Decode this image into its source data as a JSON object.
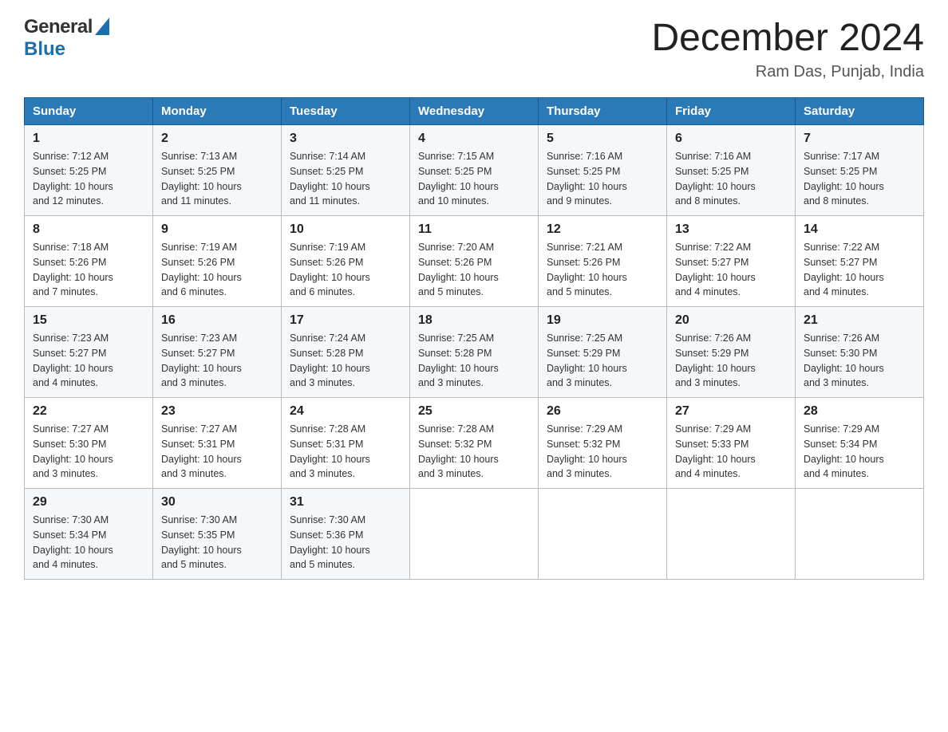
{
  "header": {
    "logo_general": "General",
    "logo_blue": "Blue",
    "month_title": "December 2024",
    "location": "Ram Das, Punjab, India"
  },
  "days_of_week": [
    "Sunday",
    "Monday",
    "Tuesday",
    "Wednesday",
    "Thursday",
    "Friday",
    "Saturday"
  ],
  "weeks": [
    [
      {
        "day": "1",
        "sunrise": "7:12 AM",
        "sunset": "5:25 PM",
        "daylight": "10 hours and 12 minutes."
      },
      {
        "day": "2",
        "sunrise": "7:13 AM",
        "sunset": "5:25 PM",
        "daylight": "10 hours and 11 minutes."
      },
      {
        "day": "3",
        "sunrise": "7:14 AM",
        "sunset": "5:25 PM",
        "daylight": "10 hours and 11 minutes."
      },
      {
        "day": "4",
        "sunrise": "7:15 AM",
        "sunset": "5:25 PM",
        "daylight": "10 hours and 10 minutes."
      },
      {
        "day": "5",
        "sunrise": "7:16 AM",
        "sunset": "5:25 PM",
        "daylight": "10 hours and 9 minutes."
      },
      {
        "day": "6",
        "sunrise": "7:16 AM",
        "sunset": "5:25 PM",
        "daylight": "10 hours and 8 minutes."
      },
      {
        "day": "7",
        "sunrise": "7:17 AM",
        "sunset": "5:25 PM",
        "daylight": "10 hours and 8 minutes."
      }
    ],
    [
      {
        "day": "8",
        "sunrise": "7:18 AM",
        "sunset": "5:26 PM",
        "daylight": "10 hours and 7 minutes."
      },
      {
        "day": "9",
        "sunrise": "7:19 AM",
        "sunset": "5:26 PM",
        "daylight": "10 hours and 6 minutes."
      },
      {
        "day": "10",
        "sunrise": "7:19 AM",
        "sunset": "5:26 PM",
        "daylight": "10 hours and 6 minutes."
      },
      {
        "day": "11",
        "sunrise": "7:20 AM",
        "sunset": "5:26 PM",
        "daylight": "10 hours and 5 minutes."
      },
      {
        "day": "12",
        "sunrise": "7:21 AM",
        "sunset": "5:26 PM",
        "daylight": "10 hours and 5 minutes."
      },
      {
        "day": "13",
        "sunrise": "7:22 AM",
        "sunset": "5:27 PM",
        "daylight": "10 hours and 4 minutes."
      },
      {
        "day": "14",
        "sunrise": "7:22 AM",
        "sunset": "5:27 PM",
        "daylight": "10 hours and 4 minutes."
      }
    ],
    [
      {
        "day": "15",
        "sunrise": "7:23 AM",
        "sunset": "5:27 PM",
        "daylight": "10 hours and 4 minutes."
      },
      {
        "day": "16",
        "sunrise": "7:23 AM",
        "sunset": "5:27 PM",
        "daylight": "10 hours and 3 minutes."
      },
      {
        "day": "17",
        "sunrise": "7:24 AM",
        "sunset": "5:28 PM",
        "daylight": "10 hours and 3 minutes."
      },
      {
        "day": "18",
        "sunrise": "7:25 AM",
        "sunset": "5:28 PM",
        "daylight": "10 hours and 3 minutes."
      },
      {
        "day": "19",
        "sunrise": "7:25 AM",
        "sunset": "5:29 PM",
        "daylight": "10 hours and 3 minutes."
      },
      {
        "day": "20",
        "sunrise": "7:26 AM",
        "sunset": "5:29 PM",
        "daylight": "10 hours and 3 minutes."
      },
      {
        "day": "21",
        "sunrise": "7:26 AM",
        "sunset": "5:30 PM",
        "daylight": "10 hours and 3 minutes."
      }
    ],
    [
      {
        "day": "22",
        "sunrise": "7:27 AM",
        "sunset": "5:30 PM",
        "daylight": "10 hours and 3 minutes."
      },
      {
        "day": "23",
        "sunrise": "7:27 AM",
        "sunset": "5:31 PM",
        "daylight": "10 hours and 3 minutes."
      },
      {
        "day": "24",
        "sunrise": "7:28 AM",
        "sunset": "5:31 PM",
        "daylight": "10 hours and 3 minutes."
      },
      {
        "day": "25",
        "sunrise": "7:28 AM",
        "sunset": "5:32 PM",
        "daylight": "10 hours and 3 minutes."
      },
      {
        "day": "26",
        "sunrise": "7:29 AM",
        "sunset": "5:32 PM",
        "daylight": "10 hours and 3 minutes."
      },
      {
        "day": "27",
        "sunrise": "7:29 AM",
        "sunset": "5:33 PM",
        "daylight": "10 hours and 4 minutes."
      },
      {
        "day": "28",
        "sunrise": "7:29 AM",
        "sunset": "5:34 PM",
        "daylight": "10 hours and 4 minutes."
      }
    ],
    [
      {
        "day": "29",
        "sunrise": "7:30 AM",
        "sunset": "5:34 PM",
        "daylight": "10 hours and 4 minutes."
      },
      {
        "day": "30",
        "sunrise": "7:30 AM",
        "sunset": "5:35 PM",
        "daylight": "10 hours and 5 minutes."
      },
      {
        "day": "31",
        "sunrise": "7:30 AM",
        "sunset": "5:36 PM",
        "daylight": "10 hours and 5 minutes."
      },
      null,
      null,
      null,
      null
    ]
  ],
  "labels": {
    "sunrise": "Sunrise:",
    "sunset": "Sunset:",
    "daylight": "Daylight:"
  }
}
